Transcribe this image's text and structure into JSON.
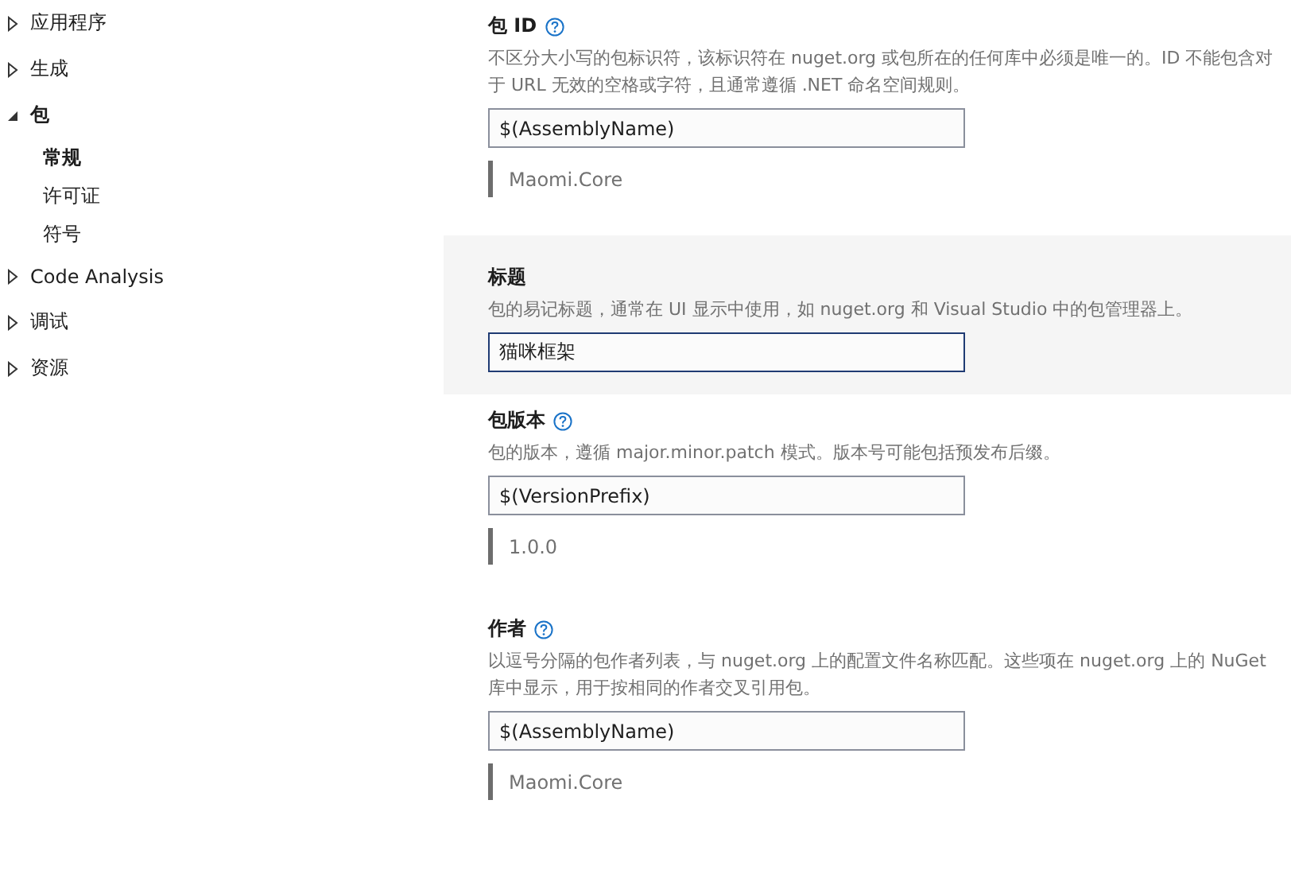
{
  "sidebar": {
    "items": [
      {
        "label": "应用程序",
        "expanded": false
      },
      {
        "label": "生成",
        "expanded": false
      },
      {
        "label": "包",
        "expanded": true,
        "children": [
          {
            "label": "常规",
            "selected": true
          },
          {
            "label": "许可证",
            "selected": false
          },
          {
            "label": "符号",
            "selected": false
          }
        ]
      },
      {
        "label": "Code Analysis",
        "expanded": false
      },
      {
        "label": "调试",
        "expanded": false
      },
      {
        "label": "资源",
        "expanded": false
      }
    ]
  },
  "settings": [
    {
      "label": "包 ID",
      "help": true,
      "focused": false,
      "description": "不区分大小写的包标识符，该标识符在 nuget.org 或包所在的任何库中必须是唯一的。ID 不能包含对于 URL 无效的空格或字符，且通常遵循 .NET 命名空间规则。",
      "value": "$(AssemblyName)",
      "evaluated": "Maomi.Core"
    },
    {
      "label": "标题",
      "help": false,
      "focused": true,
      "description": "包的易记标题，通常在 UI 显示中使用，如 nuget.org 和 Visual Studio 中的包管理器上。",
      "value": "猫咪框架"
    },
    {
      "label": "包版本",
      "help": true,
      "focused": false,
      "description": "包的版本，遵循 major.minor.patch 模式。版本号可能包括预发布后缀。",
      "value": "$(VersionPrefix)",
      "evaluated": "1.0.0"
    },
    {
      "label": "作者",
      "help": true,
      "focused": false,
      "description": "以逗号分隔的包作者列表，与 nuget.org 上的配置文件名称匹配。这些项在 nuget.org 上的 NuGet 库中显示，用于按相同的作者交叉引用包。",
      "value": "$(AssemblyName)",
      "evaluated": "Maomi.Core"
    }
  ]
}
